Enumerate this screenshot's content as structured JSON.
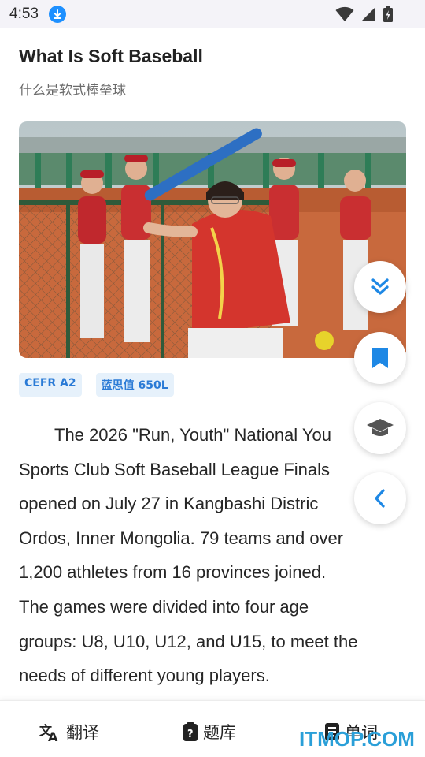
{
  "status_bar": {
    "time": "4:53",
    "icons": [
      "download-icon",
      "wifi-icon",
      "signal-icon",
      "battery-icon"
    ]
  },
  "article": {
    "title": "What Is Soft Baseball",
    "subtitle": "什么是软式棒垒球",
    "image_alt_icon": "baseball-photo",
    "badges": [
      "CEFR A2",
      "蓝思值 650L"
    ],
    "lines": [
      "The 2026 \"Run, Youth\" National You",
      "Sports Club Soft Baseball League Finals",
      "opened on July 27 in Kangbashi Distric",
      "Ordos, Inner Mongolia.  79 teams and over",
      "1,200 athletes from 16 provinces joined.",
      "The games were divided into four age",
      "groups: U8, U10, U12, and U15, to meet the",
      "needs of different young players."
    ]
  },
  "fabs": [
    "double-chevron-down-icon",
    "bookmark-icon",
    "graduation-cap-icon",
    "chevron-left-icon"
  ],
  "bottom_nav": {
    "items": [
      {
        "label": "翻译",
        "icon": "translate-icon"
      },
      {
        "label": "题库",
        "icon": "question-bank-icon"
      },
      {
        "label": "单词",
        "icon": "vocabulary-icon"
      }
    ]
  },
  "watermark": "ITMOP.COM",
  "colors": {
    "accent": "#1e88e5",
    "badge_bg": "#e6f1fb",
    "badge_text": "#2b7bd6",
    "watermark": "#2a9fd8"
  }
}
